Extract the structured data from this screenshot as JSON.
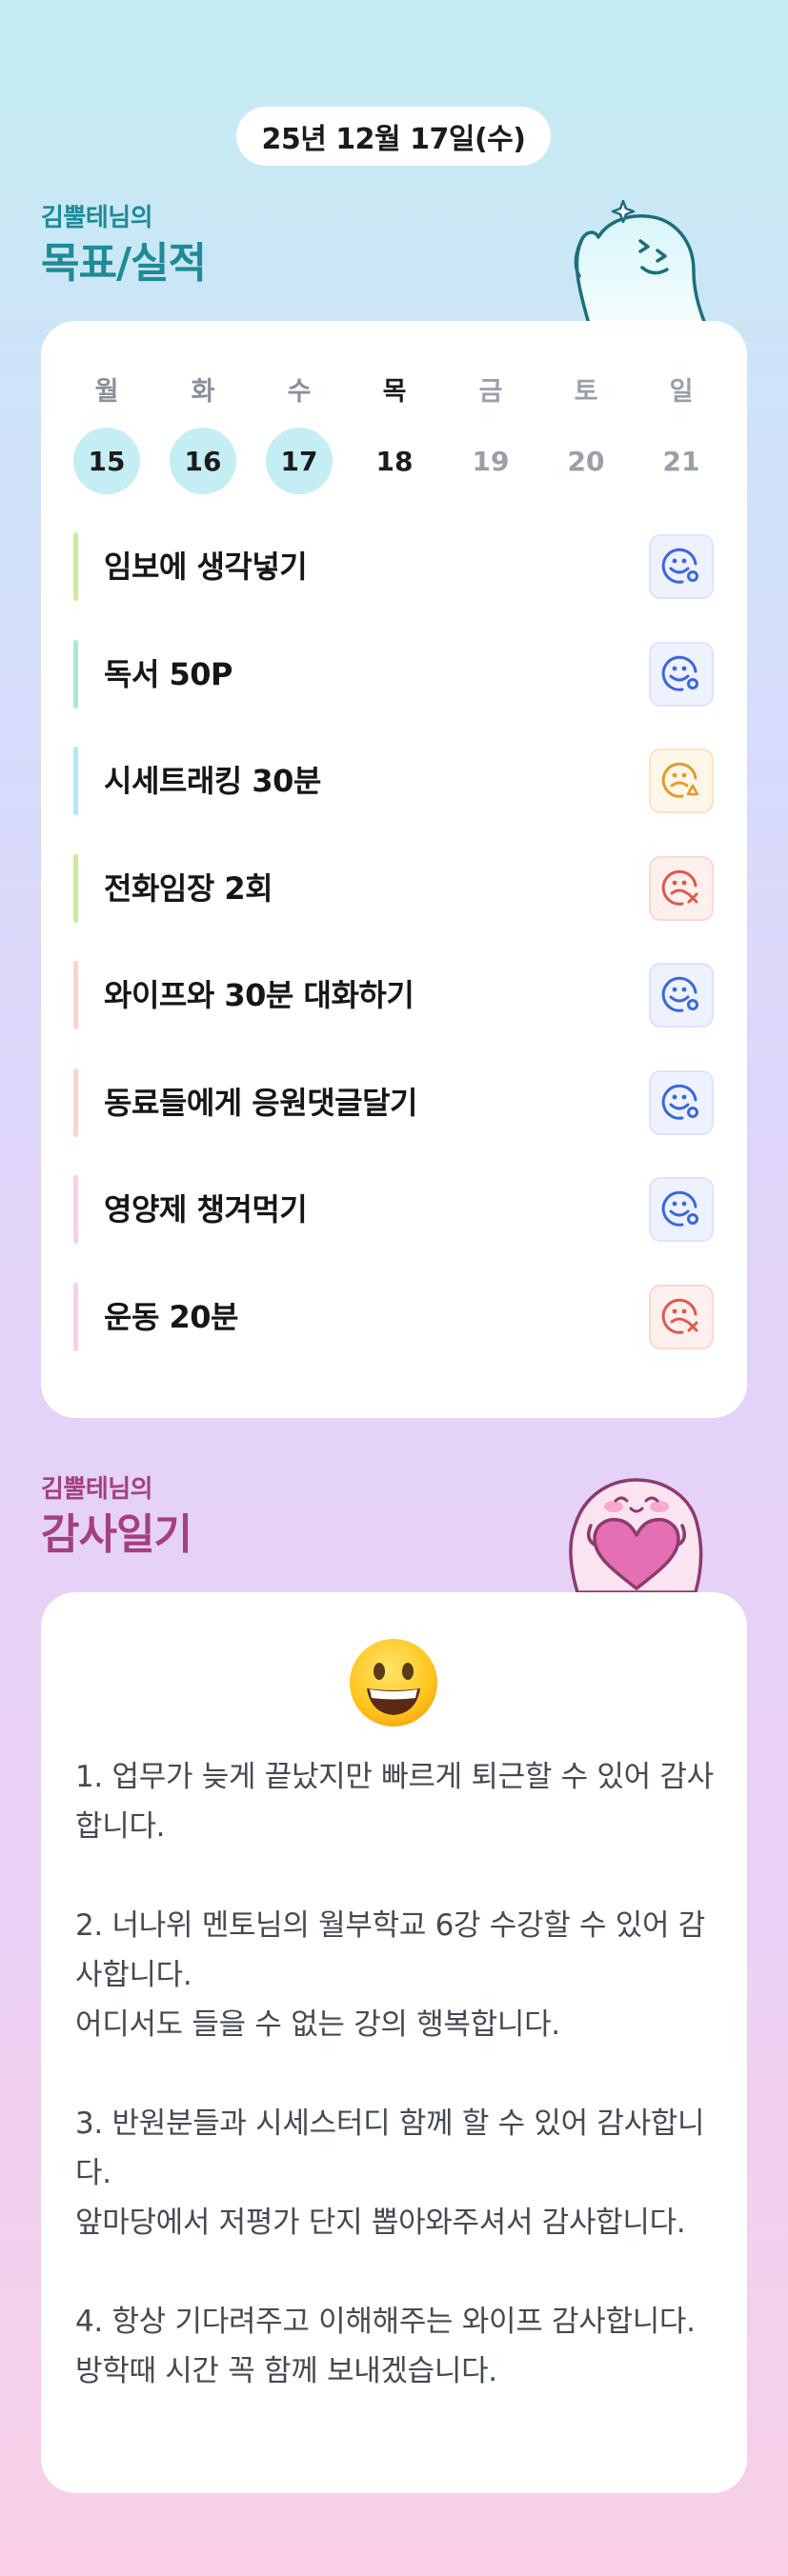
{
  "header": {
    "date": "25년 12월 17일(수)"
  },
  "goals_section": {
    "subtitle": "김뿔테님의",
    "title": "목표/실적",
    "week": [
      {
        "day": "월",
        "date": "15",
        "state": "past"
      },
      {
        "day": "화",
        "date": "16",
        "state": "past"
      },
      {
        "day": "수",
        "date": "17",
        "state": "past"
      },
      {
        "day": "목",
        "date": "18",
        "state": "today"
      },
      {
        "day": "금",
        "date": "19",
        "state": "future"
      },
      {
        "day": "토",
        "date": "20",
        "state": "future"
      },
      {
        "day": "일",
        "date": "21",
        "state": "future"
      }
    ],
    "items": [
      {
        "label": "임보에 생각넣기",
        "bar_color": "#c9ec9c",
        "status": "o"
      },
      {
        "label": "독서 50P",
        "bar_color": "#a9e9dd",
        "status": "o"
      },
      {
        "label": "시세트래킹 30분",
        "bar_color": "#b6e5f5",
        "status": "triangle"
      },
      {
        "label": "전화임장 2회",
        "bar_color": "#c9ec9c",
        "status": "x"
      },
      {
        "label": "와이프와 30분 대화하기",
        "bar_color": "#fbd3d0",
        "status": "o"
      },
      {
        "label": "동료들에게 응원댓글달기",
        "bar_color": "#fbd3d0",
        "status": "o"
      },
      {
        "label": "영양제 챙겨먹기",
        "bar_color": "#f8cfe4",
        "status": "o"
      },
      {
        "label": "운동 20분",
        "bar_color": "#f8cfe4",
        "status": "x"
      }
    ],
    "status_colors": {
      "o": "#3a66e0",
      "triangle": "#e59a2a",
      "x": "#e0584c"
    }
  },
  "gratitude_section": {
    "subtitle": "김뿔테님의",
    "title": "감사일기",
    "mood_icon": "grinning-face-icon",
    "text": "1. 업무가 늦게 끝났지만 빠르게 퇴근할 수 있어 감사합니다.\n\n2. 너나위 멘토님의 월부학교 6강 수강할 수 있어 감사합니다.\n어디서도 들을 수 없는 강의 행복합니다.\n\n3. 반원분들과 시세스터디 함께 할 수 있어 감사합니다.\n앞마당에서 저평가 단지 뽑아와주셔서 감사합니다.\n\n4. 항상 기다려주고 이해해주는 와이프 감사합니다.\n방학때 시간 꼭 함께 보내겠습니다."
  }
}
